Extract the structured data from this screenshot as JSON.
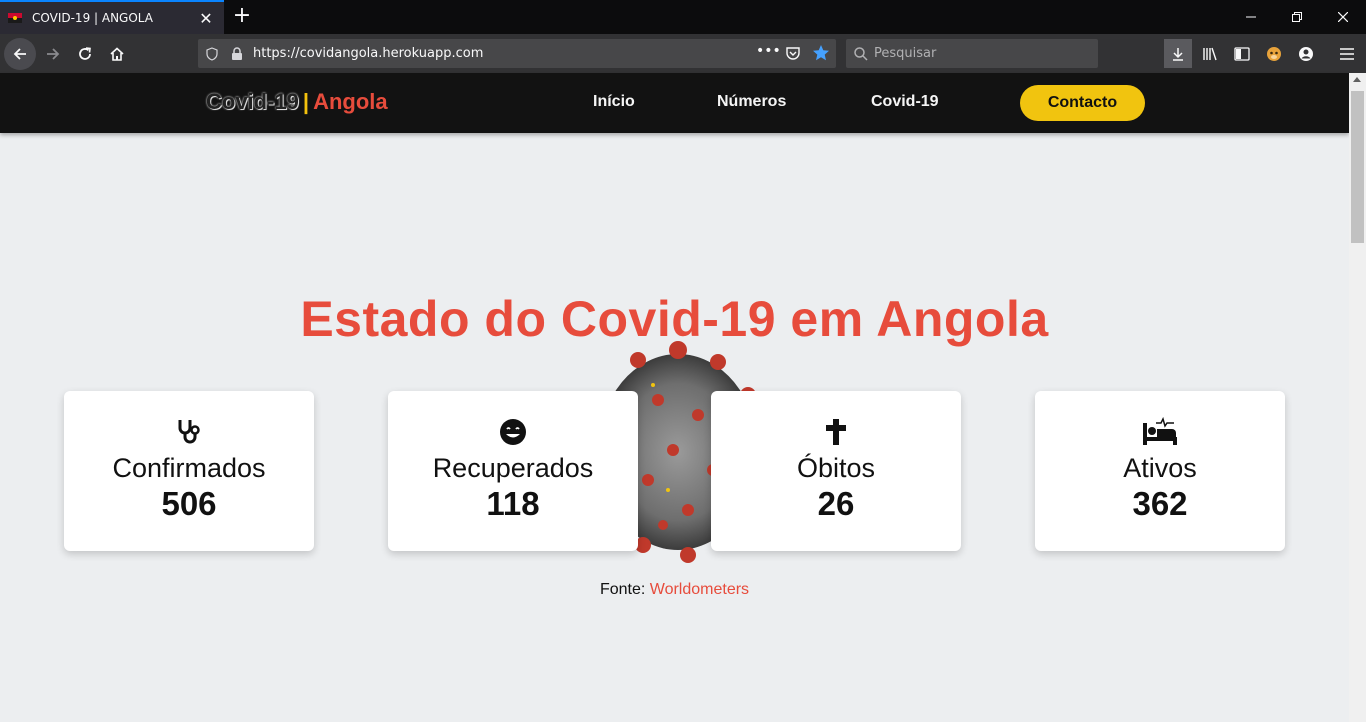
{
  "browser": {
    "tab_title": "COVID-19 | ANGOLA",
    "tab_close": "✕",
    "new_tab": "+",
    "url": "https://covidangola.herokuapp.com",
    "search_placeholder": "Pesquisar"
  },
  "header": {
    "brand_part1": "Covid-19",
    "brand_sep": "|",
    "brand_part2": "Angola",
    "menu": [
      "Início",
      "Números",
      "Covid-19"
    ],
    "contact_label": "Contacto"
  },
  "main": {
    "headline": "Estado do Covid-19 em Angola",
    "cards": [
      {
        "icon": "stethoscope-icon",
        "label": "Confirmados",
        "value": "506"
      },
      {
        "icon": "smile-icon",
        "label": "Recuperados",
        "value": "118"
      },
      {
        "icon": "cross-icon",
        "label": "Óbitos",
        "value": "26"
      },
      {
        "icon": "bed-icon",
        "label": "Ativos",
        "value": "362"
      }
    ],
    "source_prefix": "Fonte:",
    "source_link": "Worldometers"
  },
  "colors": {
    "accent_red": "#e74c3c",
    "accent_yellow": "#f1c40f",
    "header_bg": "#121212"
  }
}
